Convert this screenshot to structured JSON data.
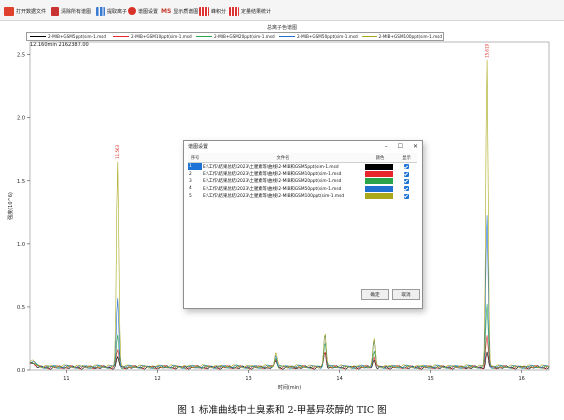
{
  "toolbar": {
    "open_label": "打开数据文件",
    "clear_label": "清除所有谱图",
    "extract_label": "提取离子",
    "settings_label": "谱图设置",
    "ms_label": "MS",
    "show_ms_label": "显示质谱图",
    "integrate_label": "峰积分",
    "peak_stats_label": "定量结果统计"
  },
  "chart": {
    "title": "总离子色谱图",
    "legend": [
      {
        "label": "2-MIB+GSM5ppt(sim-1.msd",
        "color": "#000000"
      },
      {
        "label": "2-MIB+GSM10ppt(sim-1.msd",
        "color": "#e8262b"
      },
      {
        "label": "2-MIB+GSM20ppt(sim-1.msd",
        "color": "#2aa34a"
      },
      {
        "label": "2-MIB+GSM50ppt(sim-1.msd",
        "color": "#1f6fd0"
      },
      {
        "label": "2-MIB+GSM100ppt(sim-1.msd",
        "color": "#aaa81a"
      }
    ],
    "readout": "12.160min 2162387.00",
    "xlabel": "时间(min)",
    "ylabel": "强度(10^6)"
  },
  "chart_data": {
    "type": "line",
    "title": "总离子色谱图",
    "xlabel": "时间(min)",
    "ylabel": "强度(10^6)",
    "xlim": [
      10.6,
      16.3
    ],
    "ylim": [
      0,
      2.6
    ],
    "xticks": [
      11,
      12,
      13,
      14,
      15,
      16
    ],
    "yticks": [
      0.0,
      0.5,
      1.0,
      1.5,
      2.0,
      2.5
    ],
    "peaks": [
      {
        "rt": 11.563,
        "label": "11.563",
        "heights": [
          0.08,
          0.14,
          0.25,
          0.55,
          1.65
        ]
      },
      {
        "rt": 13.3,
        "label": "",
        "heights": [
          0.05,
          0.06,
          0.07,
          0.1,
          0.12
        ]
      },
      {
        "rt": 13.84,
        "label": "",
        "heights": [
          0.12,
          0.14,
          0.2,
          0.26,
          0.27
        ]
      },
      {
        "rt": 14.38,
        "label": "",
        "heights": [
          0.06,
          0.09,
          0.13,
          0.2,
          0.22
        ]
      },
      {
        "rt": 15.619,
        "label": "15.619",
        "heights": [
          0.12,
          0.25,
          0.5,
          1.2,
          2.45
        ]
      }
    ],
    "series": [
      {
        "name": "2-MIB+GSM5ppt(sim-1.msd",
        "color": "#000000"
      },
      {
        "name": "2-MIB+GSM10ppt(sim-1.msd",
        "color": "#e8262b"
      },
      {
        "name": "2-MIB+GSM20ppt(sim-1.msd",
        "color": "#2aa34a"
      },
      {
        "name": "2-MIB+GSM50ppt(sim-1.msd",
        "color": "#1f6fd0"
      },
      {
        "name": "2-MIB+GSM100ppt(sim-1.msd",
        "color": "#aaa81a"
      }
    ]
  },
  "dialog": {
    "title": "谱图设置",
    "min_icon": "–",
    "max_icon": "☐",
    "close_icon": "✕",
    "columns": [
      "序号",
      "文件名",
      "颜色",
      "显示"
    ],
    "rows": [
      {
        "index": "1",
        "file": "E:\\工作\\结果总结\\2023\\土腥素等\\曲线\\2-MIB和GSM5ppt(sim-1.msd",
        "color": "#000000"
      },
      {
        "index": "2",
        "file": "E:\\工作\\结果总结\\2023\\土腥素等\\曲线\\2-MIB和GSM10ppt(sim-1.msd",
        "color": "#e8262b"
      },
      {
        "index": "3",
        "file": "E:\\工作\\结果总结\\2023\\土腥素等\\曲线\\2-MIB和GSM20ppt(sim-1.msd",
        "color": "#2aa34a"
      },
      {
        "index": "4",
        "file": "E:\\工作\\结果总结\\2023\\土腥素等\\曲线\\2-MIB和GSM50ppt(sim-1.msd",
        "color": "#1f6fd0"
      },
      {
        "index": "5",
        "file": "E:\\工作\\结果总结\\2023\\土腥素等\\曲线\\2-MIB和GSM100ppt(sim-1.msd",
        "color": "#aaa81a"
      }
    ],
    "ok_label": "确定",
    "cancel_label": "取消"
  },
  "caption": "图 1 标准曲线中土臭素和 2-甲基异莰醇的 TIC 图"
}
